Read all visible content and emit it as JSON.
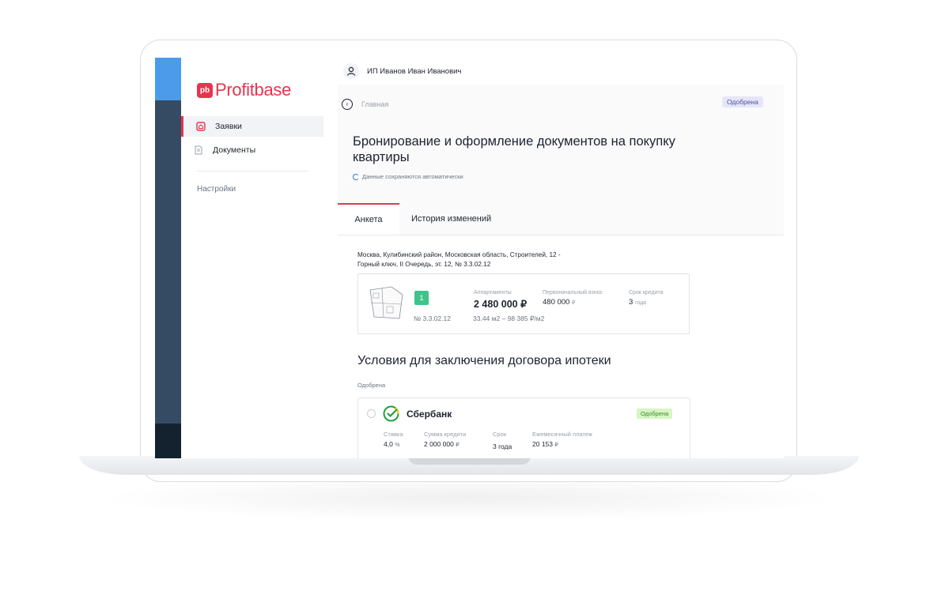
{
  "app": {
    "logo_badge": "pb",
    "logo_text": "Profitbase",
    "brand_color": "#e8344e"
  },
  "sidebar": {
    "items": [
      {
        "label": "Заявки",
        "icon": "house-icon",
        "active": true
      },
      {
        "label": "Документы",
        "icon": "document-icon",
        "active": false
      }
    ],
    "settings_label": "Настройки"
  },
  "header": {
    "user_name": "ИП Иванов Иван Иванович"
  },
  "breadcrumb": {
    "home": "Главная"
  },
  "request": {
    "status": "Одобрена",
    "title": "Бронирование и оформление документов на покупку квартиры",
    "autosave": "Данные сохраняются автоматически"
  },
  "tabs": [
    {
      "label": "Анкета",
      "active": true
    },
    {
      "label": "История изменений",
      "active": false
    }
  ],
  "flat": {
    "address_line1": "Москва, Кулибинский район, Московская область, Строителей, 12 -",
    "address_line2": "Горный ключ, II Очередь, эт. 12, № 3.3.02.12",
    "floor_badge": "1",
    "number": "№ 3.3.02.12",
    "type_label": "Аппартаменты",
    "price": "2 480 000 ₽",
    "area": "33.44 м2 – 98 385 ₽/м2",
    "down_payment_label": "Первоначальный взнос",
    "down_payment": "480 000",
    "down_payment_unit": "₽",
    "term_label": "Срок кредита",
    "term": "3",
    "term_unit": "года"
  },
  "mortgage": {
    "section_title": "Условия для заключения договора ипотеки",
    "group_label": "Одобрена",
    "bank": {
      "name": "Сбербанк",
      "icon": "sberbank-logo-icon",
      "status": "Одобрена",
      "rate_label": "Ставка",
      "rate": "4,0",
      "rate_unit": "%",
      "amount_label": "Сумма кредита",
      "amount": "2 000 000",
      "amount_unit": "₽",
      "term_label": "Срок",
      "term": "3 года",
      "payment_label": "Ежемесячный платеж",
      "payment": "20 153",
      "payment_unit": "₽"
    }
  }
}
